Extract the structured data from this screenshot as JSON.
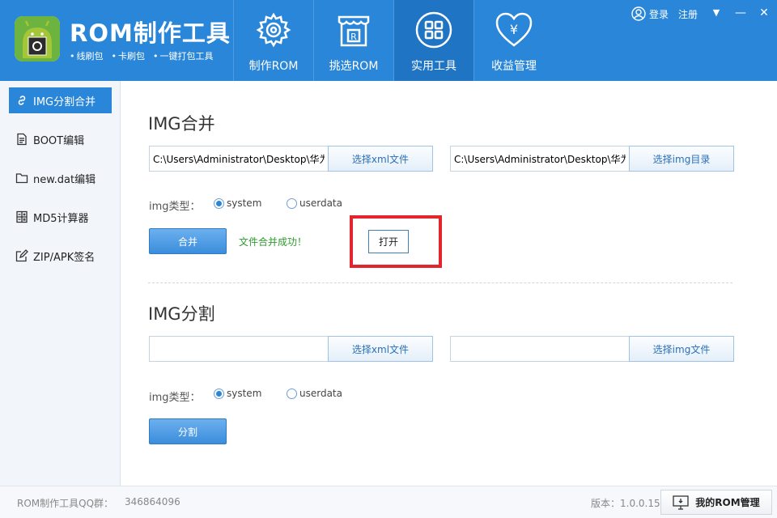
{
  "header": {
    "app_title": "ROM制作工具",
    "subtitle": [
      "线刷包",
      "卡刷包",
      "一键打包工具"
    ],
    "nav": [
      {
        "label": "制作ROM",
        "icon": "gear-icon",
        "active": false
      },
      {
        "label": "挑选ROM",
        "icon": "store-icon",
        "active": false
      },
      {
        "label": "实用工具",
        "icon": "grid-icon",
        "active": true
      },
      {
        "label": "收益管理",
        "icon": "heart-yen-icon",
        "active": false
      }
    ],
    "login": "登录",
    "register": "注册",
    "chevron": "▼",
    "minimize": "—",
    "close": "✕"
  },
  "sidebar": {
    "items": [
      {
        "label": "IMG分割合并",
        "icon": "link-icon",
        "active": true
      },
      {
        "label": "BOOT编辑",
        "icon": "document-icon",
        "active": false
      },
      {
        "label": "new.dat编辑",
        "icon": "folder-icon",
        "active": false
      },
      {
        "label": "MD5计算器",
        "icon": "calculator-icon",
        "active": false
      },
      {
        "label": "ZIP/APK签名",
        "icon": "edit-icon",
        "active": false
      }
    ]
  },
  "merge": {
    "title": "IMG合并",
    "xml_path": "C:\\Users\\Administrator\\Desktop\\华为",
    "xml_button": "选择xml文件",
    "img_dir_path": "C:\\Users\\Administrator\\Desktop\\华为",
    "img_dir_button": "选择img目录",
    "type_label": "img类型：",
    "options": [
      "system",
      "userdata"
    ],
    "selected": "system",
    "action_button": "合并",
    "status": "文件合并成功！",
    "open_button": "打开"
  },
  "split": {
    "title": "IMG分割",
    "xml_path": "",
    "xml_button": "选择xml文件",
    "img_path": "",
    "img_button": "选择img文件",
    "type_label": "img类型：",
    "options": [
      "system",
      "userdata"
    ],
    "selected": "system",
    "action_button": "分割"
  },
  "footer": {
    "qq_label": "ROM制作工具QQ群：",
    "qq_number": "346864096",
    "version": "版本：1.0.0.15",
    "my_rom_button": "我的ROM管理"
  },
  "colors": {
    "header_blue": "#2a86d8",
    "active_nav": "#1f74c4",
    "success_green": "#2e9a2e",
    "highlight_red": "#e3262d"
  }
}
